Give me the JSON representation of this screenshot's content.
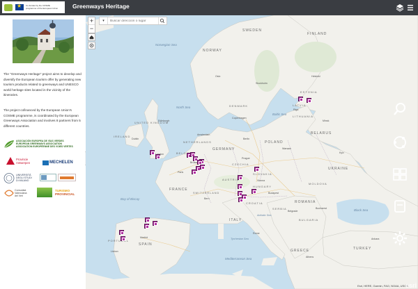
{
  "header": {
    "title": "Greenways Heritage",
    "cosme_text": "Co-funded by the COSME programme of the European Union"
  },
  "sidebar": {
    "paragraph1": "The \"Greenways Heritage\" project aims to develop and diversify the European tourism offer by generating new tourism products related to greenways and UNESCO world heritage sites located in the vicinity of the itineraries.",
    "paragraph2": "The project cofinanced by the European Union's COSME programme, is coordinated by the European Greenways Association and involves 8 partners from 5 different countries.",
    "partners": {
      "aevv_line1": "ASOCIACIÓN EUROPEA DE VÍAS VERDES",
      "aevv_line2": "EUROPEAN GREENWAYS ASSOCIATION",
      "aevv_line3": "ASSOCIATION EUROPÉENNE DES VOIES VERTES",
      "antwerp_line1": "Provincie",
      "antwerp_line2": "Antwerpen",
      "mechelen": "MECHELEN",
      "milano_line1": "UNIVERSITÀ",
      "milano_line2": "DEGLI STUDI",
      "milano_line3": "DI MILANO",
      "valencia_line1": "Comunitat",
      "valencia_line2": "Valenciana",
      "valencia_line3": "del Veri",
      "turismo_line1": "TURISMO",
      "turismo_line2": "PROVINCIAL"
    }
  },
  "map": {
    "search_placeholder": "Buscar dirección o lugar",
    "attribution": "Esri, HERE, Garmin, FAO, NOAA, USGS",
    "esri_logo": "esri",
    "countries": [
      "SWEDEN",
      "FINLAND",
      "NORWAY",
      "ESTONIA",
      "LATVIA",
      "LITHUANIA",
      "DENMARK",
      "UNITED KINGDOM",
      "IRELAND",
      "NETHERLANDS",
      "BELGIUM",
      "GERMANY",
      "POLAND",
      "BELARUS",
      "CZECHIA",
      "SLOVAKIA",
      "AUSTRIA",
      "HUNGARY",
      "UKRAINE",
      "MOLDOVA",
      "FRANCE",
      "SWITZERLAND",
      "CROATIA",
      "ROMANIA",
      "SERBIA",
      "BULGARIA",
      "ITALY",
      "SPAIN",
      "PORTUGAL",
      "GREECE",
      "TURKEY"
    ],
    "seas": [
      "North Sea",
      "Baltic Sea",
      "Norwegian Sea",
      "Bay of Biscay",
      "Black Sea",
      "Mediterranean Sea",
      "Tyrrhenian Sea",
      "Adriatic Sea"
    ],
    "cities": [
      "Oslo",
      "Stockholm",
      "Helsinki",
      "Riga",
      "Copenhagen",
      "London",
      "Dublin",
      "Amsterdam",
      "Brussels",
      "Berlin",
      "Paris",
      "Prague",
      "Vienna",
      "Warsaw",
      "Kyiv",
      "Budapest",
      "Bern",
      "Belgrade",
      "Bucharest",
      "Rome",
      "Madrid",
      "Lisbon",
      "Athens",
      "Ankara",
      "Minsk",
      "Edinburgh"
    ],
    "marker_count": 24
  },
  "colors": {
    "header_bg": "#3a3d42",
    "water": "#c7dfee",
    "land": "#f2f1ec",
    "marker": "#b02ea0"
  }
}
